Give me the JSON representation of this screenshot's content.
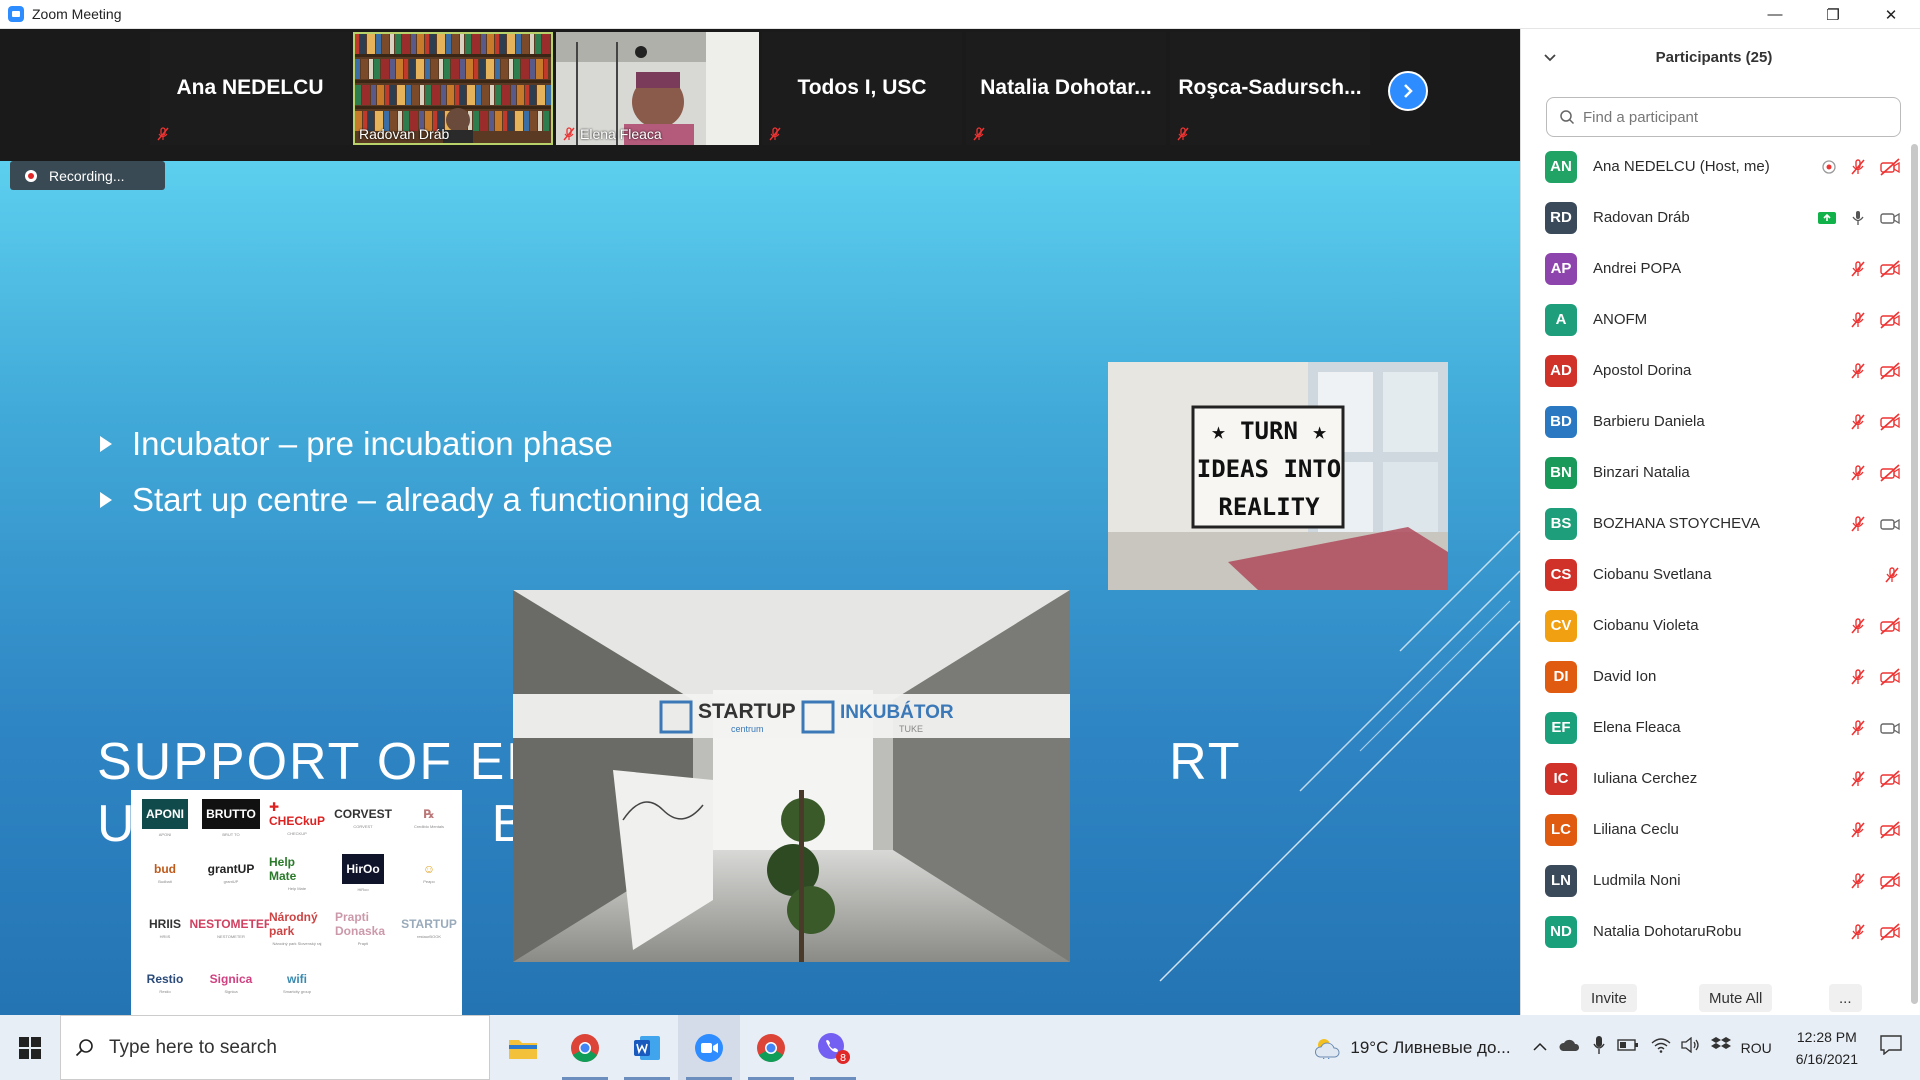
{
  "window": {
    "title": "Zoom Meeting",
    "minimize": "—",
    "maximize": "❐",
    "close": "✕"
  },
  "tiles": [
    {
      "name": "Ana NEDELCU",
      "video": false
    },
    {
      "name": "Radovan Dráb",
      "video": true
    },
    {
      "name": "Elena Fleaca",
      "video": true
    },
    {
      "name": "Todos I, USC",
      "video": false
    },
    {
      "name": "Natalia  Dohotar...",
      "video": false
    },
    {
      "name": "Roşca-Sadursch...",
      "video": false
    }
  ],
  "recording": {
    "label": "Recording..."
  },
  "slide": {
    "bullets": [
      "Incubator – pre incubation phase",
      "Start up centre – already a functioning idea"
    ],
    "title_line1": "SUPPORT OF ENTR",
    "title_line1_end": "RT",
    "title_line2": "U",
    "title_line2_mid": "BU",
    "ideas_sign": [
      "★ TURN ★",
      "IDEAS INTO",
      "REALITY"
    ],
    "banner_startup": "STARTUP",
    "banner_startup_sub": "centrum",
    "banner_inkubator": "INKUBÁTOR",
    "banner_inkubator_sub": "TUKE",
    "logos": [
      {
        "text": "APONI",
        "caption": "APONI",
        "color": "#fff",
        "bg": "#114a4a"
      },
      {
        "text": "BRUTTO",
        "caption": "BRUT TO",
        "color": "#fff",
        "bg": "#111"
      },
      {
        "text": "✚ CHECkuP",
        "caption": "CHECKUP",
        "color": "#d22",
        "bg": "#fff"
      },
      {
        "text": "CORVEST",
        "caption": "CORVEST",
        "color": "#333",
        "bg": "#fff"
      },
      {
        "text": "℞",
        "caption": "Crediblo Mentals",
        "color": "#b77",
        "bg": "#fff"
      },
      {
        "text": "bud",
        "caption": "Budbait",
        "color": "#c05a1a",
        "bg": "#fff"
      },
      {
        "text": "grantUP",
        "caption": "grantUP",
        "color": "#222",
        "bg": "#fff"
      },
      {
        "text": "Help Mate",
        "caption": "Help Mate",
        "color": "#2a7a2a",
        "bg": "#fff"
      },
      {
        "text": "HirOo",
        "caption": "HiRoo",
        "color": "#fff",
        "bg": "#10142a"
      },
      {
        "text": "☺",
        "caption": "Peapo",
        "color": "#e0a020",
        "bg": "#fff"
      },
      {
        "text": "HRIIS",
        "caption": "HRIIS",
        "color": "#333",
        "bg": "#fff"
      },
      {
        "text": "NESTOMETER",
        "caption": "NESTOMETER",
        "color": "#d04060",
        "bg": "#fff"
      },
      {
        "text": "Národný park",
        "caption": "Národný park Slovenský raj",
        "color": "#c44",
        "bg": "#fff"
      },
      {
        "text": "Prapti Donaska",
        "caption": "Prapti",
        "color": "#c9a",
        "bg": "#fff"
      },
      {
        "text": "STARTUP",
        "caption": "restaurBOOK",
        "color": "#9ab",
        "bg": "#fff"
      },
      {
        "text": "Restio",
        "caption": "Restio",
        "color": "#2a4a7a",
        "bg": "#fff"
      },
      {
        "text": "Signica",
        "caption": "Signica",
        "color": "#d04080",
        "bg": "#fff"
      },
      {
        "text": "wifi",
        "caption": "Smartcity group",
        "color": "#3a8ab0",
        "bg": "#fff"
      }
    ]
  },
  "panel": {
    "title": "Participants (25)",
    "search_placeholder": "Find a participant",
    "invite": "Invite",
    "mute_all": "Mute All",
    "more": "..."
  },
  "participants": [
    {
      "initials": "AN",
      "name": "Ana NEDELCU (Host, me)",
      "color": "#21a366",
      "mic": "muted",
      "video": "off",
      "extra": "record"
    },
    {
      "initials": "RD",
      "name": "Radovan Dráb",
      "color": "#3a4a5a",
      "mic": "on",
      "video": "on",
      "extra": "share"
    },
    {
      "initials": "AP",
      "name": "Andrei POPA",
      "color": "#8e44ad",
      "mic": "muted",
      "video": "off"
    },
    {
      "initials": "A",
      "name": "ANOFM",
      "color": "#1e9e7a",
      "mic": "muted",
      "video": "off"
    },
    {
      "initials": "AD",
      "name": "Apostol Dorina",
      "color": "#d0322a",
      "mic": "muted",
      "video": "off"
    },
    {
      "initials": "BD",
      "name": "Barbieru Daniela",
      "color": "#2a78c2",
      "mic": "muted",
      "video": "off"
    },
    {
      "initials": "BN",
      "name": "Binzari Natalia",
      "color": "#1a9a5a",
      "mic": "muted",
      "video": "off"
    },
    {
      "initials": "BS",
      "name": "BOZHANA STOYCHEVA",
      "color": "#1e9e7a",
      "mic": "muted",
      "video": "on"
    },
    {
      "initials": "CS",
      "name": "Ciobanu Svetlana",
      "color": "#d0322a",
      "mic": "muted",
      "video": "none"
    },
    {
      "initials": "CV",
      "name": "Ciobanu Violeta",
      "color": "#f0a010",
      "mic": "muted",
      "video": "off"
    },
    {
      "initials": "DI",
      "name": "David Ion",
      "color": "#e05a10",
      "mic": "muted",
      "video": "off"
    },
    {
      "initials": "EF",
      "name": "Elena Fleaca",
      "color": "#1aa07a",
      "mic": "muted",
      "video": "on"
    },
    {
      "initials": "IC",
      "name": "Iuliana Cerchez",
      "color": "#d0322a",
      "mic": "muted",
      "video": "off"
    },
    {
      "initials": "LC",
      "name": "Liliana Ceclu",
      "color": "#e05a10",
      "mic": "muted",
      "video": "off"
    },
    {
      "initials": "LN",
      "name": "Ludmila Noni",
      "color": "#3a4a5a",
      "mic": "muted",
      "video": "off"
    },
    {
      "initials": "ND",
      "name": "Natalia DohotaruRobu",
      "color": "#1aa07a",
      "mic": "muted",
      "video": "off"
    }
  ],
  "taskbar": {
    "search_placeholder": "Type here to search",
    "weather": "19°C  Ливневые до...",
    "lang": "ROU",
    "time": "12:28 PM",
    "date": "6/16/2021",
    "viber_badge": "8"
  }
}
